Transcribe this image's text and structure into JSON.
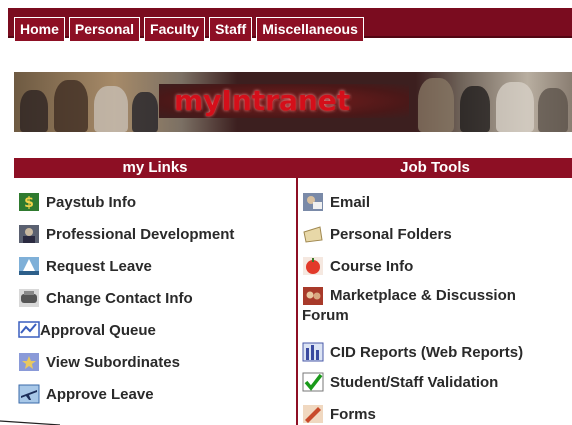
{
  "nav": {
    "tabs": [
      "Home",
      "Personal",
      "Faculty",
      "Staff",
      "Miscellaneous"
    ]
  },
  "banner": {
    "title": "myIntranet"
  },
  "my_links": {
    "header": "my Links",
    "items": [
      {
        "label": "Paystub Info",
        "icon": "paystub-icon"
      },
      {
        "label": "Professional Development",
        "icon": "professional-development-icon"
      },
      {
        "label": "Request Leave",
        "icon": "request-leave-icon"
      },
      {
        "label": "Change Contact Info",
        "icon": "contact-info-icon"
      },
      {
        "label": "Approval Queue",
        "icon": "approval-queue-icon"
      },
      {
        "label": "View Subordinates",
        "icon": "subordinates-icon"
      },
      {
        "label": "Approve Leave",
        "icon": "approve-leave-icon"
      }
    ]
  },
  "job_tools": {
    "header": "Job Tools",
    "items": [
      {
        "label": "Email",
        "icon": "email-icon"
      },
      {
        "label": "Personal Folders",
        "icon": "folders-icon"
      },
      {
        "label": "Course Info",
        "icon": "course-info-icon"
      },
      {
        "label": "Marketplace & Discussion",
        "label2": "Forum",
        "icon": "marketplace-icon"
      },
      {
        "label": "CID Reports (Web Reports)",
        "icon": "reports-icon"
      },
      {
        "label": "Student/Staff Validation",
        "icon": "checkmark-icon"
      },
      {
        "label": "Forms",
        "icon": "forms-icon"
      }
    ]
  },
  "colors": {
    "accent": "#8d0f24",
    "topbar": "#7a0c1f",
    "title_red": "#d40f1a"
  }
}
